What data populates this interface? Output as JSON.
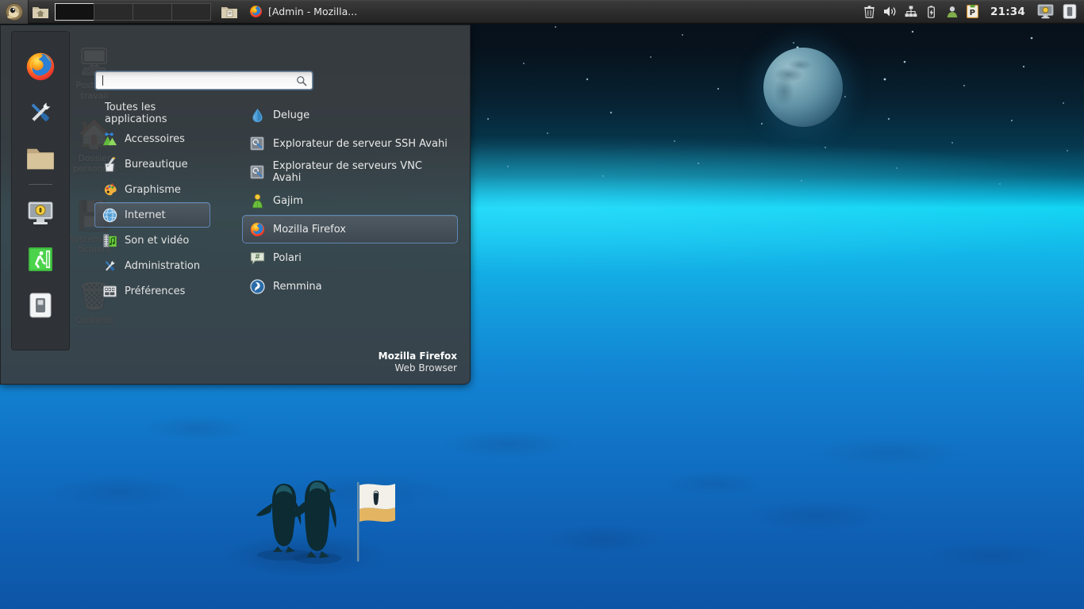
{
  "panel": {
    "menu_button_icon": "xfce-mouse-logo-icon",
    "launchers": [
      {
        "name": "file-manager-home-launcher",
        "icon": "folder-home-icon"
      },
      {
        "name": "file-manager-launcher",
        "icon": "folder-documents-icon"
      }
    ],
    "workspaces": [
      {
        "label": "",
        "active": true
      },
      {
        "label": "",
        "active": false
      },
      {
        "label": "",
        "active": false
      },
      {
        "label": "",
        "active": false
      }
    ],
    "tasks": [
      {
        "title": "[Admin - Mozilla...",
        "icon": "firefox-icon"
      }
    ],
    "tray": [
      {
        "name": "trash-icon",
        "glyph": "trash"
      },
      {
        "name": "volume-icon",
        "glyph": "speaker"
      },
      {
        "name": "network-icon",
        "glyph": "network"
      },
      {
        "name": "battery-icon",
        "glyph": "battery"
      },
      {
        "name": "user-icon",
        "glyph": "user"
      },
      {
        "name": "clipboard-icon",
        "glyph": "clipboard-P"
      }
    ],
    "clock": "21:34",
    "right_buttons": [
      {
        "name": "display-settings-button",
        "glyph": "monitor"
      },
      {
        "name": "device-button",
        "glyph": "tablet"
      }
    ]
  },
  "desktop": {
    "icons": [
      {
        "label": "Poste de travail",
        "icon": "computer-icon"
      },
      {
        "label": "Dossier personnel",
        "icon": "home-folder-icon"
      },
      {
        "label": "Système de fichiers",
        "icon": "drive-icon"
      },
      {
        "label": "Corbeille",
        "icon": "trash-icon"
      }
    ]
  },
  "menu": {
    "search": {
      "value": "",
      "placeholder": "",
      "icon": "search-icon"
    },
    "favorites": [
      {
        "name": "favorite-firefox",
        "icon": "firefox-icon"
      },
      {
        "name": "favorite-settings",
        "icon": "tools-icon"
      },
      {
        "name": "favorite-file-manager",
        "icon": "folder-icon"
      },
      {
        "name": "favorite-lock-screen",
        "icon": "lock-screen-icon"
      },
      {
        "name": "favorite-log-out",
        "icon": "logout-icon"
      },
      {
        "name": "favorite-switch-user",
        "icon": "switch-user-icon"
      }
    ],
    "categories": [
      {
        "label": "Toutes les applications",
        "icon": "",
        "selected": false
      },
      {
        "label": "Accessoires",
        "icon": "accessories-icon",
        "selected": false
      },
      {
        "label": "Bureautique",
        "icon": "office-icon",
        "selected": false
      },
      {
        "label": "Graphisme",
        "icon": "graphics-icon",
        "selected": false
      },
      {
        "label": "Internet",
        "icon": "internet-globe-icon",
        "selected": true
      },
      {
        "label": "Son et vidéo",
        "icon": "multimedia-icon",
        "selected": false
      },
      {
        "label": "Administration",
        "icon": "administration-icon",
        "selected": false
      },
      {
        "label": "Préférences",
        "icon": "preferences-icon",
        "selected": false
      }
    ],
    "applications": [
      {
        "label": "Deluge",
        "icon": "deluge-drop-icon",
        "selected": false
      },
      {
        "label": "Explorateur de serveur SSH Avahi",
        "icon": "avahi-ssh-icon",
        "selected": false
      },
      {
        "label": "Explorateur de serveurs VNC Avahi",
        "icon": "avahi-vnc-icon",
        "selected": false
      },
      {
        "label": "Gajim",
        "icon": "gajim-icon",
        "selected": false
      },
      {
        "label": "Mozilla Firefox",
        "icon": "firefox-icon",
        "selected": true
      },
      {
        "label": "Polari",
        "icon": "polari-icon",
        "selected": false
      },
      {
        "label": "Remmina",
        "icon": "remmina-icon",
        "selected": false
      }
    ],
    "description": {
      "title": "Mozilla Firefox",
      "subtitle": "Web Browser"
    }
  },
  "colors": {
    "accent": "#5f87b5",
    "panel_bg": "#2e2e2e",
    "menu_bg": "#3a3e42",
    "wallpaper_top": "#071019",
    "wallpaper_horizon": "#12d0f0",
    "wallpaper_bottom": "#0d55a6"
  }
}
